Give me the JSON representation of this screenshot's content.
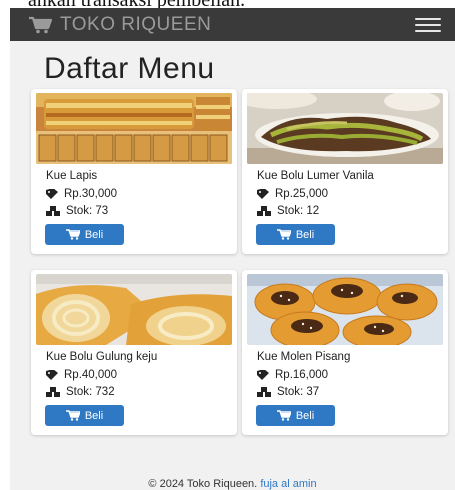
{
  "page_behind": {
    "caption": "ahkan transaksi pembelian."
  },
  "navbar": {
    "brand": "TOKO RIQUEEN",
    "cart_icon": "shopping-cart-icon",
    "menu_icon": "hamburger-menu-icon",
    "background": "#3a3a3a"
  },
  "page": {
    "title": "Daftar Menu"
  },
  "colors": {
    "button": "#2f78c4",
    "content_bg": "#f1f1f1"
  },
  "products": [
    {
      "name": "Kue Lapis",
      "price": "Rp.30,000",
      "stock": "Stok: 73",
      "button": "Beli",
      "image": "kue-lapis-photo"
    },
    {
      "name": "Kue Bolu Lumer Vanila",
      "price": "Rp.25,000",
      "stock": "Stok: 12",
      "button": "Beli",
      "image": "kue-bolu-lumer-vanila-photo"
    },
    {
      "name": "Kue Bolu Gulung keju",
      "price": "Rp.40,000",
      "stock": "Stok: 732",
      "button": "Beli",
      "image": "kue-bolu-gulung-keju-photo"
    },
    {
      "name": "Kue Molen Pisang",
      "price": "Rp.16,000",
      "stock": "Stok: 37",
      "button": "Beli",
      "image": "kue-molen-pisang-photo"
    }
  ],
  "footer": {
    "text": "© 2024 Toko Riqueen.",
    "link": "fuja al amin"
  }
}
